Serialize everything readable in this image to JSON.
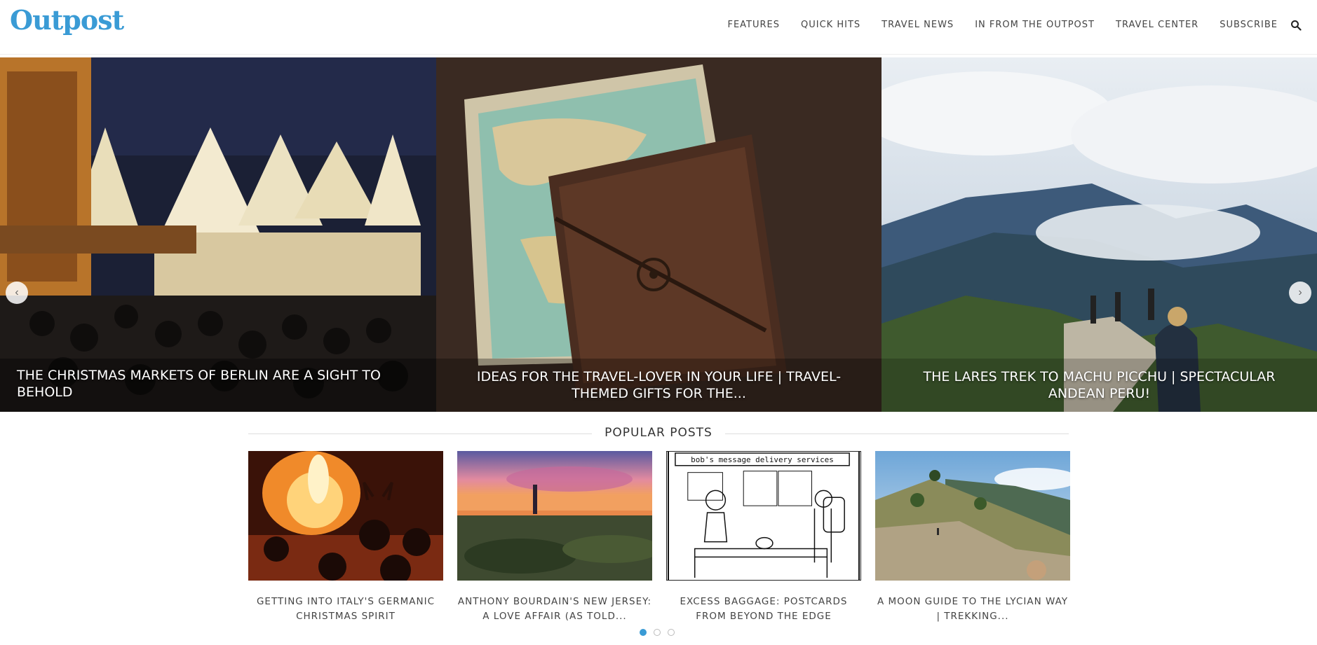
{
  "header": {
    "logo": "Outpost",
    "nav": [
      "FEATURES",
      "QUICK HITS",
      "TRAVEL NEWS",
      "IN FROM THE OUTPOST",
      "TRAVEL CENTER",
      "SUBSCRIBE"
    ],
    "search_icon": "search-icon"
  },
  "slider": {
    "prev_icon": "chevron-left-icon",
    "next_icon": "chevron-right-icon",
    "slides": [
      {
        "caption": "THE CHRISTMAS MARKETS OF BERLIN ARE A SIGHT TO BEHOLD"
      },
      {
        "caption": "IDEAS FOR THE TRAVEL-LOVER IN YOUR LIFE | TRAVEL-THEMED GIFTS FOR THE..."
      },
      {
        "caption": "THE LARES TREK TO MACHU PICCHU | SPECTACULAR ANDEAN PERU!"
      }
    ]
  },
  "popular": {
    "title": "POPULAR POSTS",
    "posts": [
      {
        "title": "GETTING INTO ITALY'S GERMANIC CHRISTMAS SPIRIT"
      },
      {
        "title": "ANTHONY BOURDAIN'S NEW JERSEY: A LOVE AFFAIR (AS TOLD..."
      },
      {
        "title": "EXCESS BAGGAGE: POSTCARDS FROM BEYOND THE EDGE"
      },
      {
        "title": "A MOON GUIDE TO THE LYCIAN WAY | TREKKING..."
      }
    ],
    "cartoon_text": "bob's message delivery services"
  },
  "colors": {
    "accent": "#3a9bd5"
  }
}
